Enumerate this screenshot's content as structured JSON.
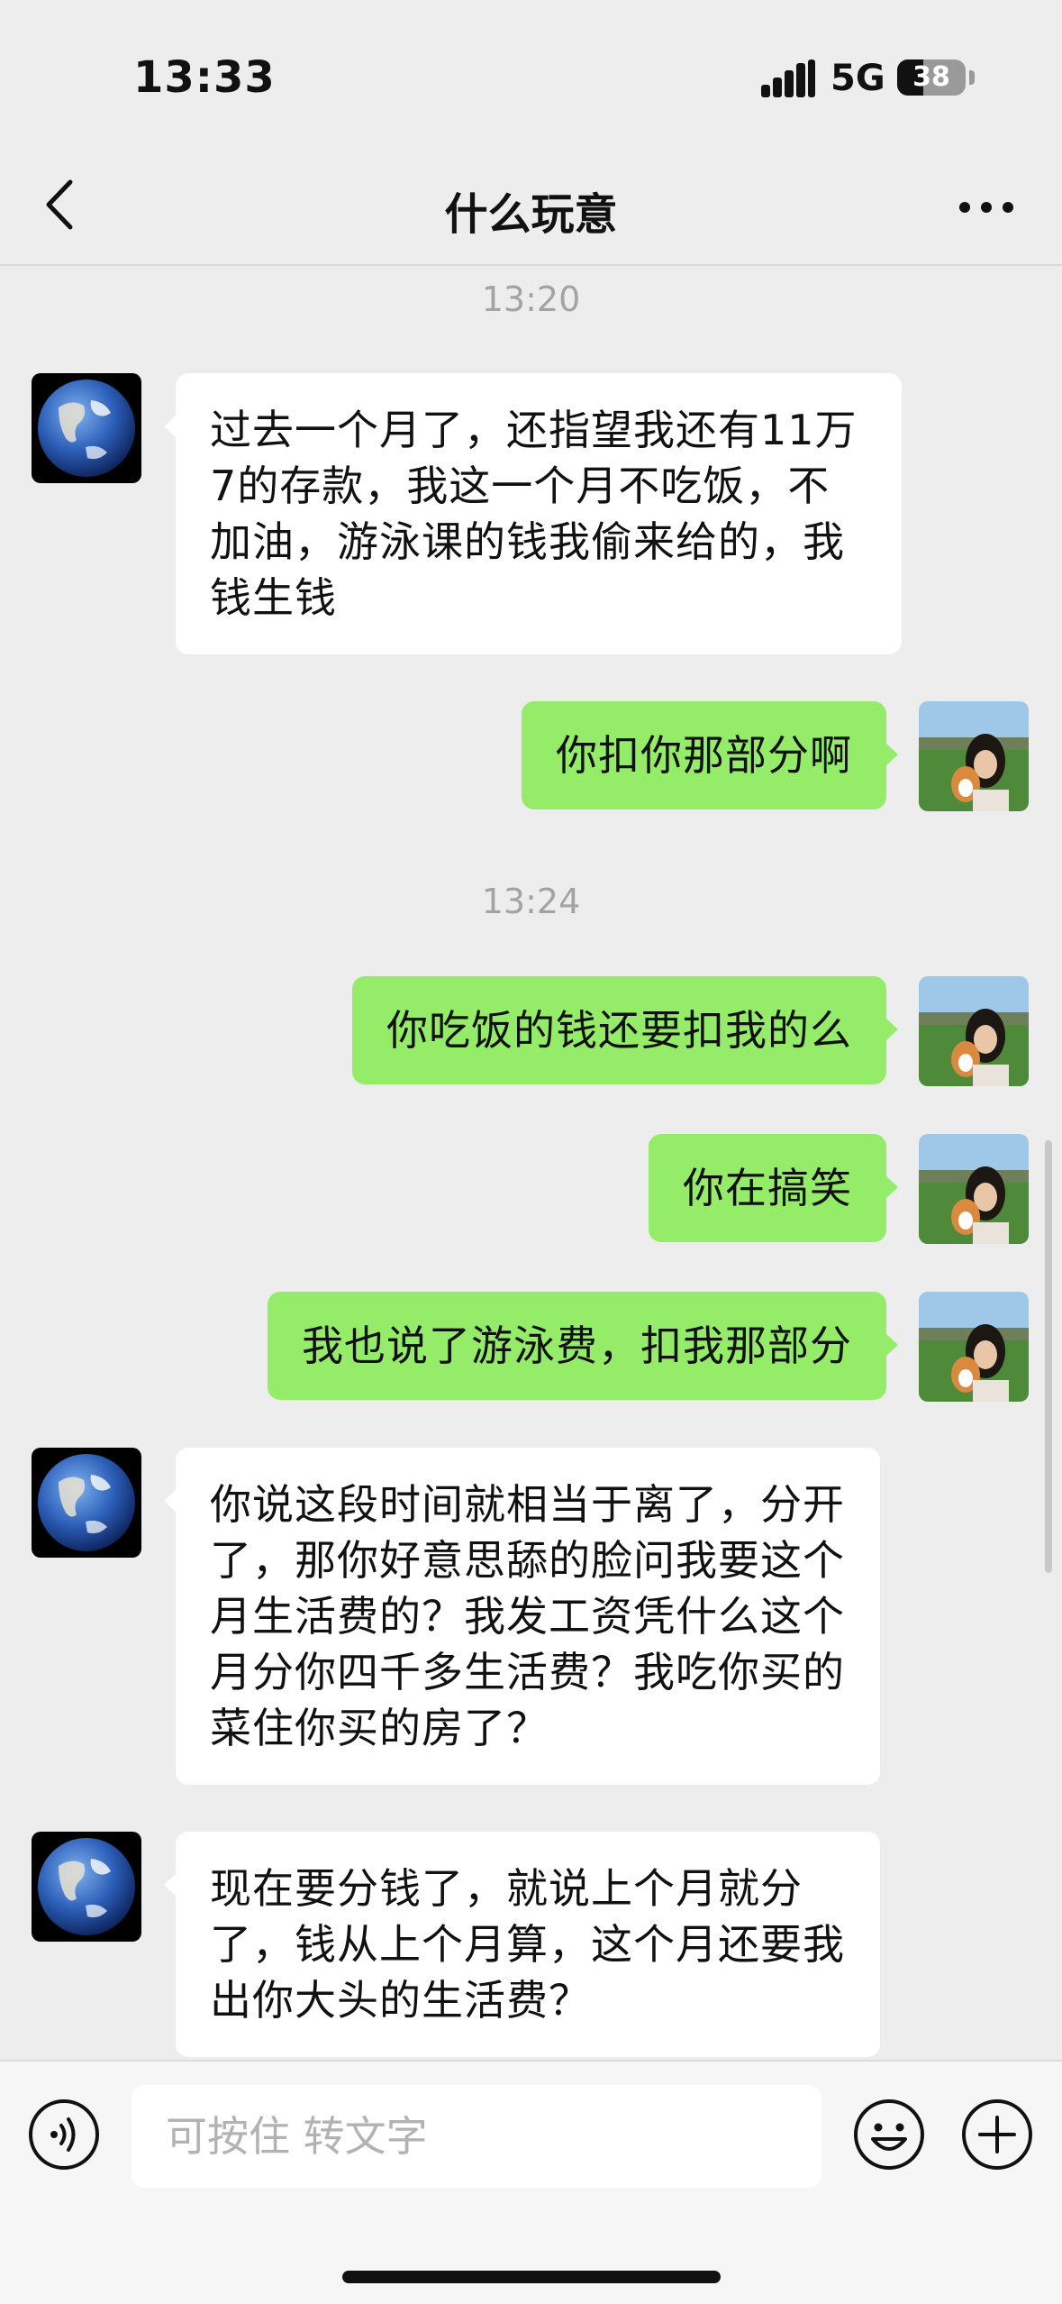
{
  "status_bar": {
    "time": "13:33",
    "network": "5G",
    "battery_level": "38",
    "battery_fraction": 0.38
  },
  "header": {
    "back_icon": "chevron-left-icon",
    "title": "什么玩意",
    "more_icon": "more-dots-icon"
  },
  "messages": {
    "timestamp_1": "13:20",
    "m1": {
      "sender": "contact",
      "avatar": "earth-avatar",
      "text": "过去一个月了，还指望我还有11万7的存款，我这一个月不吃饭，不加油，游泳课的钱我偷来给的，我钱生钱"
    },
    "m2": {
      "sender": "me",
      "avatar": "selfie-with-dog-avatar",
      "text": "你扣你那部分啊"
    },
    "timestamp_2": "13:24",
    "m3": {
      "sender": "me",
      "text": "你吃饭的钱还要扣我的么"
    },
    "m4": {
      "sender": "me",
      "text": "你在搞笑"
    },
    "m5": {
      "sender": "me",
      "text": "我也说了游泳费，扣我那部分"
    },
    "m6": {
      "sender": "contact",
      "text": "你说这段时间就相当于离了，分开了，那你好意思舔的脸问我要这个月生活费的？我发工资凭什么这个月分你四千多生活费？我吃你买的菜住你买的房了？"
    },
    "m7": {
      "sender": "contact",
      "text": "现在要分钱了，就说上个月就分了，钱从上个月算，这个月还要我出你大头的生活费？"
    }
  },
  "input_bar": {
    "voice_icon": "voice-input-icon",
    "placeholder": "可按住 转文字",
    "emoji_icon": "emoji-icon",
    "plus_icon": "plus-circle-icon"
  },
  "colors": {
    "background": "#ededed",
    "outgoing_bubble": "#95ec69",
    "incoming_bubble": "#ffffff",
    "timestamp_text": "#a3a3a3"
  }
}
